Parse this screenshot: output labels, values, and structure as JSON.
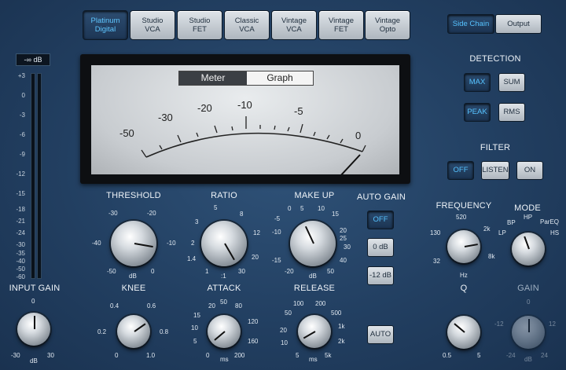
{
  "models": [
    {
      "l1": "Platinum",
      "l2": "Digital",
      "active": true
    },
    {
      "l1": "Studio",
      "l2": "VCA"
    },
    {
      "l1": "Studio",
      "l2": "FET"
    },
    {
      "l1": "Classic",
      "l2": "VCA"
    },
    {
      "l1": "Vintage",
      "l2": "VCA"
    },
    {
      "l1": "Vintage",
      "l2": "FET"
    },
    {
      "l1": "Vintage",
      "l2": "Opto"
    }
  ],
  "top_right": {
    "side_chain": "Side Chain",
    "output": "Output"
  },
  "input_meter": {
    "readout": "-∞ dB",
    "scale": [
      "+3",
      "0",
      "-3",
      "-6",
      "-9",
      "-12",
      "-15",
      "-18",
      "-21",
      "-24",
      "-30",
      "-35",
      "-40",
      "-50",
      "-60"
    ]
  },
  "meter_view": {
    "tab_meter": "Meter",
    "tab_graph": "Graph",
    "scale": [
      "-50",
      "-30",
      "-20",
      "-10",
      "-5",
      "0"
    ]
  },
  "knobs": {
    "input_gain": {
      "label": "INPUT GAIN",
      "ticks": [
        "0",
        "-30",
        "dB",
        "30"
      ]
    },
    "threshold": {
      "label": "THRESHOLD",
      "ticks": [
        "-30",
        "-20",
        "-40",
        "-10",
        "-50",
        "dB",
        "0"
      ]
    },
    "ratio": {
      "label": "RATIO",
      "ticks": [
        "5",
        "3",
        "8",
        "2",
        "12",
        "1.4",
        "20",
        "1",
        ":1",
        "30"
      ]
    },
    "makeup": {
      "label": "MAKE UP",
      "ticks": [
        "0",
        "5",
        "10",
        "-5",
        "15",
        "-10",
        "20",
        "-15",
        "30",
        "-20",
        "dB",
        "50",
        "40",
        "25"
      ]
    },
    "knee": {
      "label": "KNEE",
      "ticks": [
        "0.4",
        "0.6",
        "0.2",
        "0.8",
        "0",
        "1.0"
      ]
    },
    "attack": {
      "label": "ATTACK",
      "ticks": [
        "20",
        "50",
        "15",
        "80",
        "10",
        "120",
        "5",
        "160",
        "0",
        "ms",
        "200"
      ]
    },
    "release": {
      "label": "RELEASE",
      "ticks": [
        "100",
        "200",
        "50",
        "500",
        "20",
        "1k",
        "10",
        "2k",
        "5",
        "ms",
        "5k"
      ]
    },
    "frequency": {
      "label": "FREQUENCY",
      "ticks": [
        "520",
        "130",
        "2k",
        "32",
        "8k",
        "Hz"
      ]
    },
    "mode": {
      "label": "MODE",
      "ticks": [
        "BP",
        "HP",
        "ParEQ",
        "LP",
        "HS"
      ]
    },
    "q": {
      "label": "Q",
      "ticks": [
        "0.5",
        "5"
      ]
    },
    "gain": {
      "label": "GAIN",
      "ticks": [
        "0",
        "-12",
        "12",
        "-24",
        "dB",
        "24"
      ]
    }
  },
  "auto_gain": {
    "label": "AUTO GAIN",
    "off": "OFF",
    "zero": "0 dB",
    "minus12": "-12 dB"
  },
  "auto_button": "AUTO",
  "detection": {
    "label": "DETECTION",
    "max": "MAX",
    "sum": "SUM",
    "peak": "PEAK",
    "rms": "RMS"
  },
  "filter": {
    "label": "FILTER",
    "off": "OFF",
    "listen": "LISTEN",
    "on": "ON"
  }
}
